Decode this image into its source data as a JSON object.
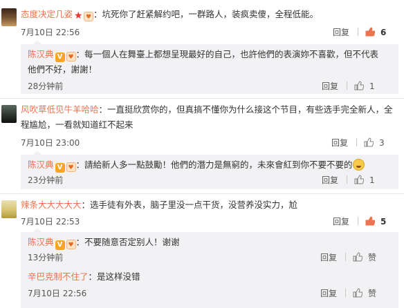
{
  "colors": {
    "username": "#eb7350",
    "like_active": "#eb7350",
    "reply_bg": "#f2f2f5"
  },
  "actions": {
    "reply_label": "回复",
    "like_label": "赞"
  },
  "comments": [
    {
      "user": "态度决定几姿",
      "badges": [
        "star",
        "heart-icon"
      ],
      "text": "：坑死你了赶紧解约吧，一群路人，装疯卖傻，全程低能。",
      "time": "7月10日 22:56",
      "likes": "6",
      "reply": {
        "user": "陈汉典",
        "text_line1": "：每一個人在舞臺上都想呈現最好的自己，也許他們的表演妳不喜歡，但不代表",
        "text_line2": "他們不好，謝謝！",
        "time": "28分钟前",
        "likes": "1"
      }
    },
    {
      "user": "风吹草低见牛羊哈哈",
      "text_line1": "：一直挺欣赏你的，但真搞不懂你为什么接这个节目，有些选手完全新人，全",
      "text_line2": "程尴尬，一看就知道红不起来",
      "time": "7月10日 23:00",
      "likes": "3",
      "reply": {
        "user": "陈汉典",
        "text": "：請給新人多一點鼓勵！他們的潛力是無窮的，未來會紅到你不要不要的",
        "time": "23分钟前",
        "likes": "1"
      }
    },
    {
      "user": "辣条大大大大大",
      "text": "：选手徒有外表，脑子里没一点干货，没营养没实力，尬",
      "time": "7月10日 22:53",
      "likes": "5",
      "reply": {
        "user": "陈汉典",
        "text": "：不要随意否定别人！谢谢",
        "time": "13分钟前",
        "likes": "赞"
      },
      "reply2": {
        "user": "辛巴克制不住了",
        "text": "：是这样没错",
        "time": "7月10日 22:56",
        "likes": "赞"
      }
    }
  ]
}
